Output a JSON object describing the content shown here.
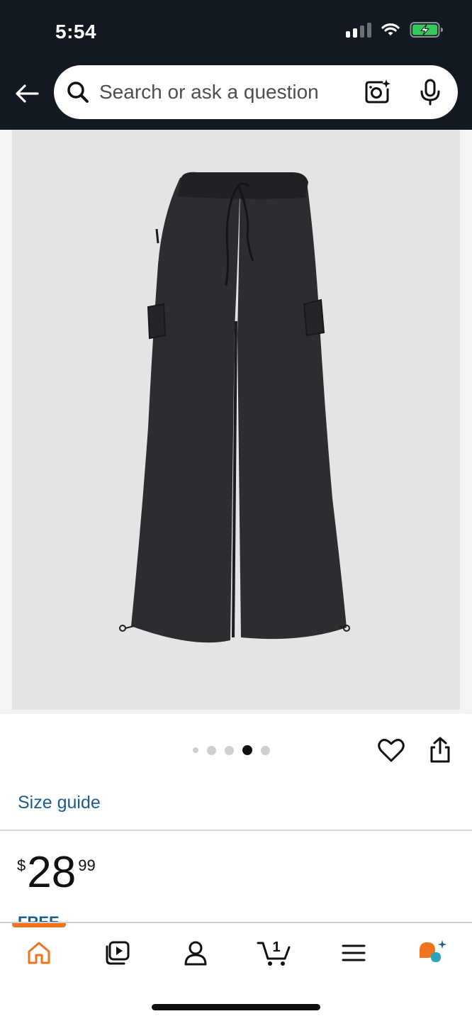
{
  "status_bar": {
    "time": "5:54",
    "icons": [
      "cellular-signal-icon",
      "wifi-icon",
      "battery-charging-icon"
    ]
  },
  "header": {
    "back_icon": "back-arrow-icon",
    "search": {
      "placeholder": "Search or ask a question",
      "value": "",
      "search_icon": "search-icon",
      "camera_icon": "camera-lens-icon",
      "mic_icon": "microphone-icon"
    }
  },
  "product": {
    "image_alt": "black cargo pants",
    "carousel": {
      "count": 5,
      "active_index": 3
    },
    "size_guide_label": "Size guide",
    "price": {
      "symbol": "$",
      "whole": "28",
      "fraction": "99"
    },
    "partial_text": "FREE Return"
  },
  "bottom_nav": {
    "active": "home",
    "items": [
      {
        "name": "home",
        "icon": "home-icon"
      },
      {
        "name": "video",
        "icon": "video-play-icon"
      },
      {
        "name": "account",
        "icon": "user-icon"
      },
      {
        "name": "cart",
        "icon": "cart-icon",
        "badge": "1"
      },
      {
        "name": "menu",
        "icon": "menu-icon"
      },
      {
        "name": "rufus",
        "icon": "rufus-assistant-icon"
      }
    ]
  },
  "colors": {
    "header_bg": "#131921",
    "accent_orange": "#f0731d",
    "link_blue": "#1f5c8c",
    "battery_green": "#34c759",
    "text_dark": "#0f1111"
  }
}
